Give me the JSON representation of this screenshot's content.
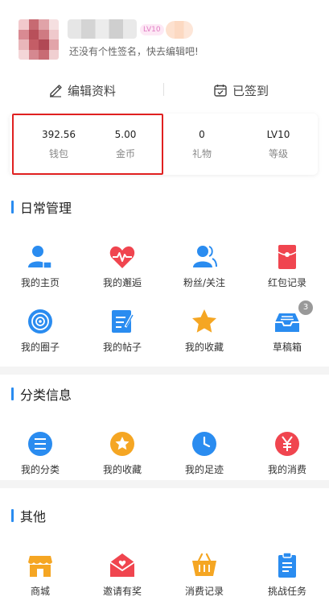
{
  "profile": {
    "level_badge": "LV10",
    "signature": "还没有个性签名，快去编辑吧!"
  },
  "actions": {
    "edit_label": "编辑资料",
    "signed_label": "已签到"
  },
  "stats": [
    {
      "value": "392.56",
      "label": "钱包"
    },
    {
      "value": "5.00",
      "label": "金币"
    },
    {
      "value": "0",
      "label": "礼物"
    },
    {
      "value": "LV10",
      "label": "等级"
    }
  ],
  "daily": {
    "title": "日常管理",
    "items": [
      {
        "label": "我的主页",
        "icon": "user-home-icon"
      },
      {
        "label": "我的邂逅",
        "icon": "heart-pulse-icon"
      },
      {
        "label": "粉丝/关注",
        "icon": "fans-icon"
      },
      {
        "label": "红包记录",
        "icon": "red-envelope-icon"
      },
      {
        "label": "我的圈子",
        "icon": "circle-target-icon"
      },
      {
        "label": "我的帖子",
        "icon": "post-edit-icon"
      },
      {
        "label": "我的收藏",
        "icon": "star-icon"
      },
      {
        "label": "草稿箱",
        "icon": "draft-box-icon",
        "badge": "3"
      }
    ]
  },
  "category": {
    "title": "分类信息",
    "items": [
      {
        "label": "我的分类",
        "icon": "category-list-icon"
      },
      {
        "label": "我的收藏",
        "icon": "collection-star-icon"
      },
      {
        "label": "我的足迹",
        "icon": "footprint-clock-icon"
      },
      {
        "label": "我的消费",
        "icon": "yuan-icon"
      }
    ]
  },
  "other": {
    "title": "其他",
    "items": [
      {
        "label": "商城",
        "icon": "shop-icon"
      },
      {
        "label": "邀请有奖",
        "icon": "invite-mail-icon"
      },
      {
        "label": "消费记录",
        "icon": "basket-icon"
      },
      {
        "label": "挑战任务",
        "icon": "task-clipboard-icon"
      }
    ]
  },
  "colors": {
    "accent": "#2a8cf0",
    "highlight": "#e02020",
    "red": "#f0454f",
    "orange": "#f5a623"
  }
}
